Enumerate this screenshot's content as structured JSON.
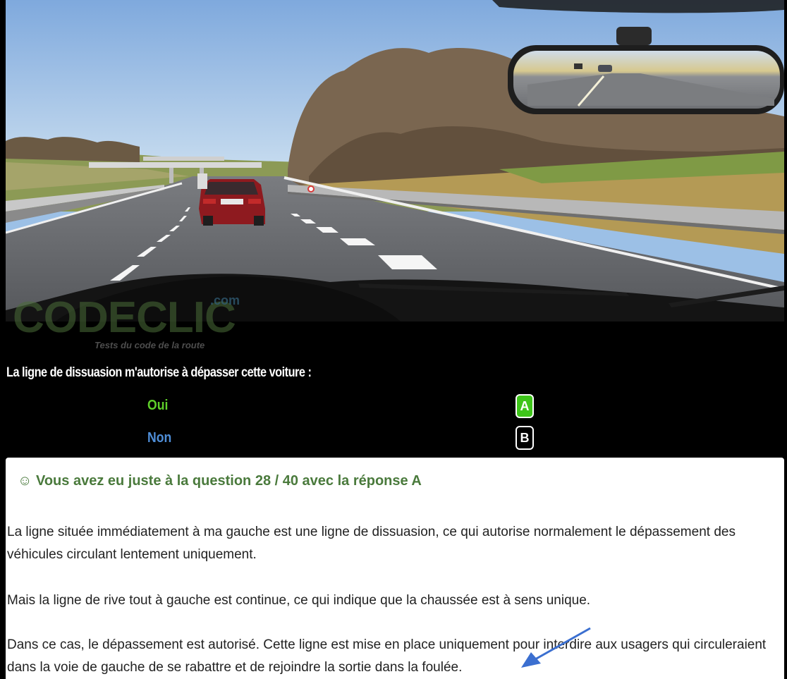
{
  "logo": {
    "brand": "CODECLIC",
    "domain": ".com",
    "tagline": "Tests du code de la route"
  },
  "quiz": {
    "question": "La ligne de dissuasion m'autorise à dépasser cette voiture :",
    "answers": [
      {
        "label": "Oui",
        "letter": "A",
        "selected": true
      },
      {
        "label": "Non",
        "letter": "B",
        "selected": false
      }
    ]
  },
  "feedback": {
    "icon": "smiley-icon",
    "icon_glyph": "☺",
    "result": "Vous avez eu juste à la question 28 / 40 avec la réponse A",
    "paragraphs": [
      "La ligne située immédiatement à ma gauche est une ligne de dissuasion, ce qui autorise normalement le dépassement des véhicules circulant lentement uniquement.",
      "Mais la ligne de rive tout à gauche est continue, ce qui indique que la chaussée est à sens unique.",
      "Dans ce cas, le dépassement est autorisé. Cette ligne est mise en place uniquement pour interdire aux usagers qui circuleraient dans la voie de gauche de se rabattre et de rejoindre la sortie dans la foulée."
    ]
  },
  "colors": {
    "answer_a": "#5fd02a",
    "answer_b": "#4f8ed8",
    "selected_button": "#3ec51a",
    "result_text": "#4a7a3c",
    "annotation_arrow": "#3b6fd0"
  }
}
